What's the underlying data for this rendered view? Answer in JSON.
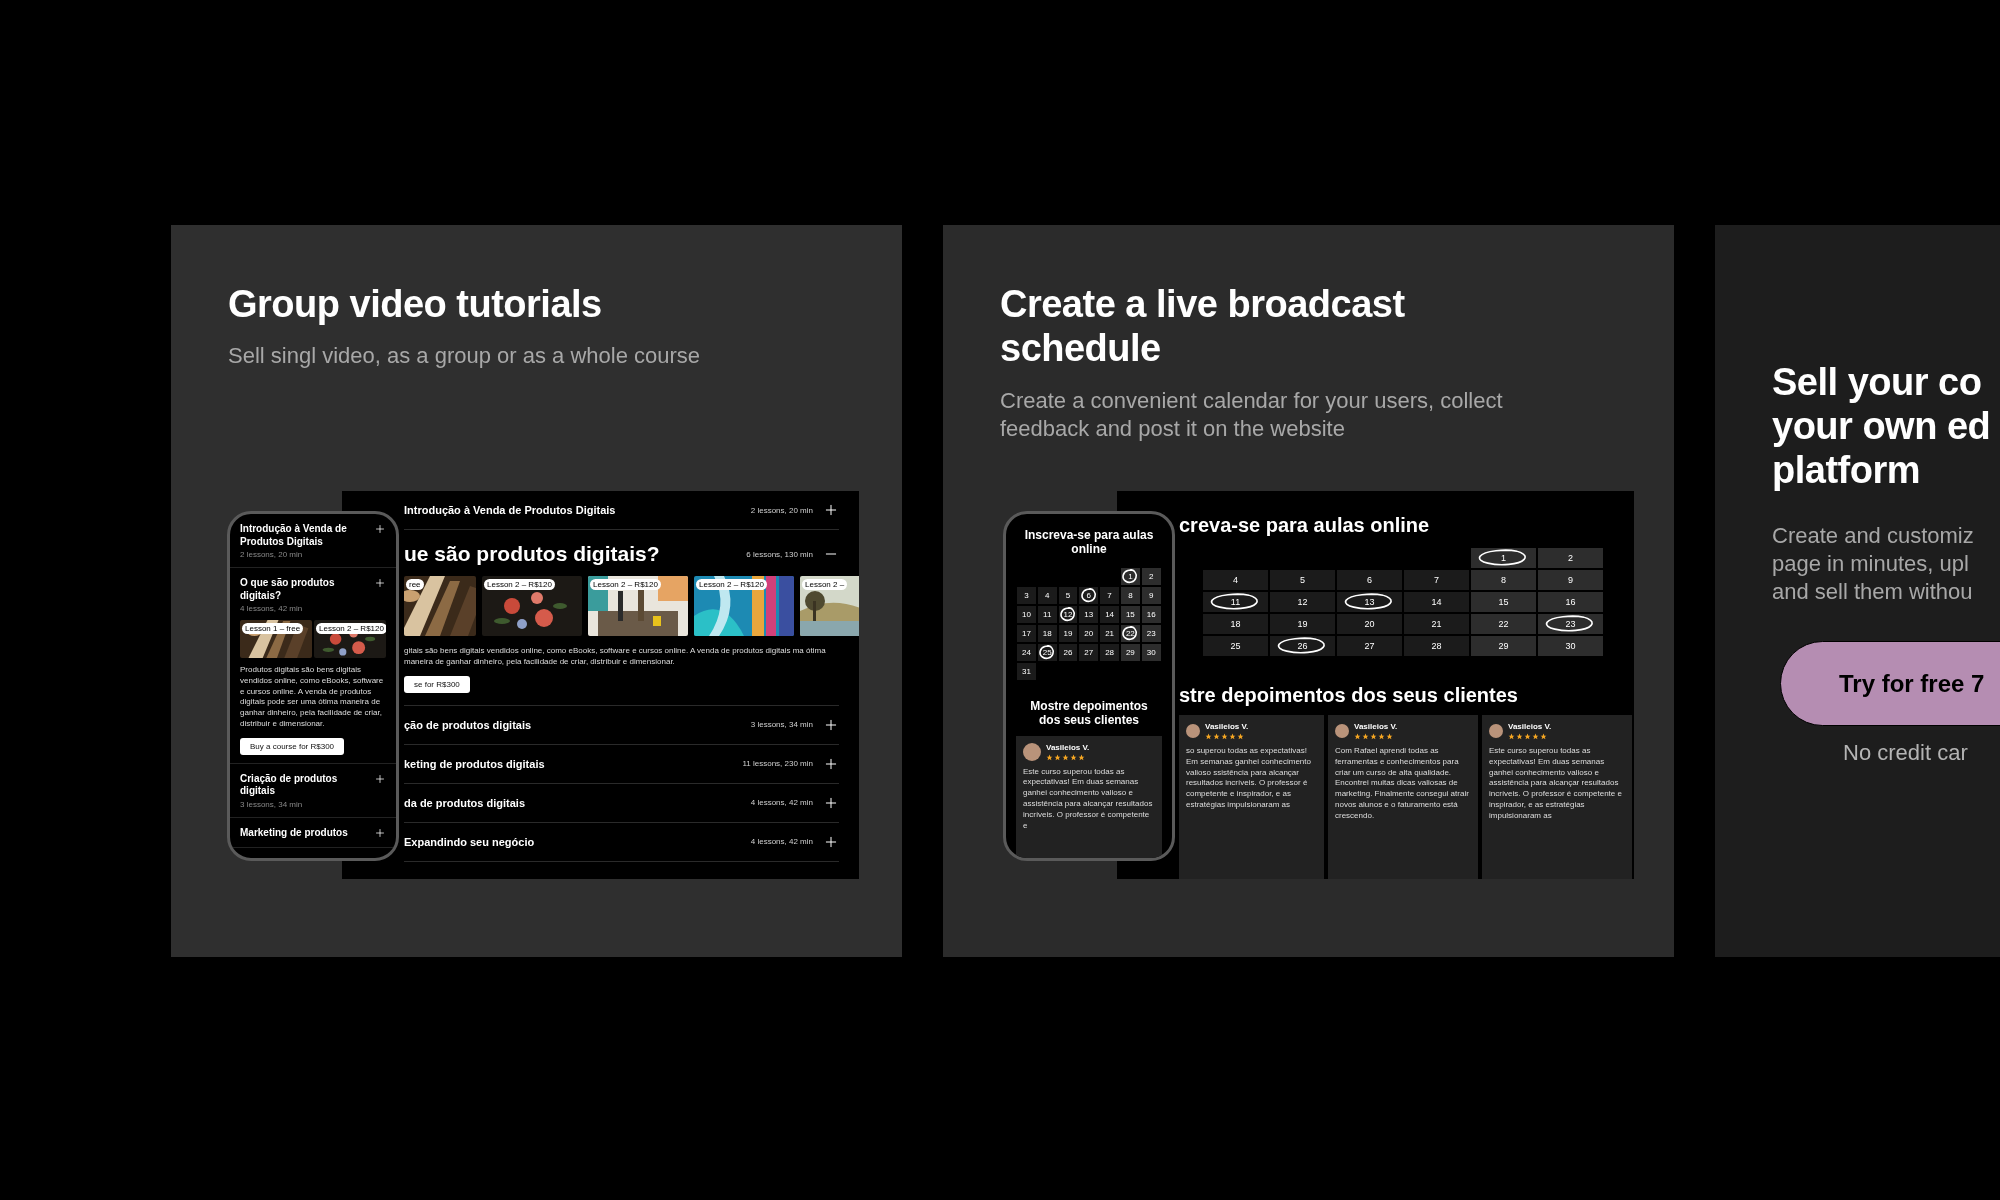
{
  "cards": [
    {
      "kind": "course",
      "title": "Group video tutorials",
      "subtitle": "Sell singl video, as a group or as a whole course",
      "desktop": {
        "sections": [
          {
            "title": "Introdução à Venda de Produtos Digitais",
            "meta": "2 lessons, 20 min",
            "expanded": false
          },
          {
            "title": "ue são produtos digitais?",
            "meta": "6 lessons, 130 min",
            "expanded": true,
            "lessons": [
              "ree",
              "Lesson 2 – R$120",
              "Lesson 2 – R$120",
              "Lesson 2 – R$120",
              "Lesson 2 –"
            ],
            "description": "gitais são bens digitais vendidos online, como eBooks, software e cursos online. A venda de produtos digitais ma ótima maneira de ganhar dinheiro, pela facilidade de criar, distribuir e dimensionar.",
            "buy": "se for R$300"
          },
          {
            "title": "ção de produtos digitais",
            "meta": "3 lessons, 34 min",
            "expanded": false
          },
          {
            "title": "keting de produtos digitais",
            "meta": "11 lessons, 230 min",
            "expanded": false
          },
          {
            "title": "da de produtos digitais",
            "meta": "4 lessons, 42 min",
            "expanded": false
          },
          {
            "title": "Expandindo seu negócio",
            "meta": "4 lessons, 42 min",
            "expanded": false
          }
        ]
      },
      "phone": {
        "sections": [
          {
            "title": "Introdução à Venda de Produtos Digitais",
            "meta": "2 lessons, 20 min",
            "expanded": false
          },
          {
            "title": "O que são produtos digitais?",
            "meta": "4 lessons, 42 min",
            "expanded": true,
            "lessons": [
              "Lesson 1 – free",
              "Lesson 2 – R$120"
            ],
            "description": "Produtos digitais são bens digitais vendidos online, como eBooks, software e cursos online. A venda de produtos digitais pode ser uma ótima maneira de ganhar dinheiro, pela facilidade de criar, distribuir e dimensionar.",
            "buy": "Buy a course for R$300"
          },
          {
            "title": "Criação de produtos digitais",
            "meta": "3 lessons, 34 min",
            "expanded": false
          },
          {
            "title": "Marketing de produtos",
            "expanded": false
          }
        ]
      }
    },
    {
      "kind": "schedule",
      "title": "Create a live broadcast schedule",
      "subtitle": "Create a convenient calendar for your users, collect feedback and post it on the website",
      "desktop": {
        "calendar_title": "creva-se para aulas online",
        "weeks": [
          [
            {
              "day": "1",
              "circled": true
            },
            {
              "day": "2",
              "circled": false
            }
          ],
          [
            {
              "day": "4",
              "circled": false
            },
            {
              "day": "5",
              "circled": false
            },
            {
              "day": "6",
              "circled": false
            },
            {
              "day": "7",
              "circled": false
            },
            {
              "day": "8",
              "circled": false
            },
            {
              "day": "9",
              "circled": false
            }
          ],
          [
            {
              "day": "11",
              "circled": true
            },
            {
              "day": "12",
              "circled": false
            },
            {
              "day": "13",
              "circled": true
            },
            {
              "day": "14",
              "circled": false
            },
            {
              "day": "15",
              "circled": false
            },
            {
              "day": "16",
              "circled": false
            }
          ],
          [
            {
              "day": "18",
              "circled": false
            },
            {
              "day": "19",
              "circled": false
            },
            {
              "day": "20",
              "circled": false
            },
            {
              "day": "21",
              "circled": false
            },
            {
              "day": "22",
              "circled": false
            },
            {
              "day": "23",
              "circled": true
            }
          ],
          [
            {
              "day": "25",
              "circled": false
            },
            {
              "day": "26",
              "circled": true
            },
            {
              "day": "27",
              "circled": false
            },
            {
              "day": "28",
              "circled": false
            },
            {
              "day": "29",
              "circled": false
            },
            {
              "day": "30",
              "circled": false
            }
          ]
        ],
        "testimonials_title": "stre depoimentos dos seus clientes",
        "testimonials": [
          {
            "name": "Vasileios V.",
            "stars": 5,
            "text": "so superou todas as expectativas! Em semanas ganhei conhecimento valioso ssistência para alcançar resultados incríveis. O professor é competente e inspirador, e as estratégias impulsionaram as"
          },
          {
            "name": "Vasileios V.",
            "stars": 5,
            "text": "Com Rafael aprendi todas as ferramentas e conhecimentos para criar um curso de alta qualidade. Encontrei muitas dicas valiosas de marketing. Finalmente consegui atrair novos alunos e o faturamento está crescendo."
          },
          {
            "name": "Vasileios V.",
            "stars": 5,
            "text": "Este curso superou todas as expectativas! Em duas semanas ganhei conhecimento valioso e assistência para alcançar resultados incríveis. O professor é competente e inspirador, e as estratégias impulsionaram as"
          }
        ]
      },
      "phone": {
        "calendar_title": "Inscreva-se para aulas online",
        "weeks": [
          [
            {
              "day": "1",
              "circled": true
            },
            {
              "day": "2",
              "circled": false
            }
          ],
          [
            {
              "day": "3",
              "circled": false
            },
            {
              "day": "4",
              "circled": false
            },
            {
              "day": "5",
              "circled": false
            },
            {
              "day": "6",
              "circled": true
            },
            {
              "day": "7",
              "circled": false
            },
            {
              "day": "8",
              "circled": false
            },
            {
              "day": "9",
              "circled": false
            }
          ],
          [
            {
              "day": "10",
              "circled": false
            },
            {
              "day": "11",
              "circled": false
            },
            {
              "day": "12",
              "circled": true
            },
            {
              "day": "13",
              "circled": false
            },
            {
              "day": "14",
              "circled": false
            },
            {
              "day": "15",
              "circled": false
            },
            {
              "day": "16",
              "circled": false
            }
          ],
          [
            {
              "day": "17",
              "circled": false
            },
            {
              "day": "18",
              "circled": false
            },
            {
              "day": "19",
              "circled": false
            },
            {
              "day": "20",
              "circled": false
            },
            {
              "day": "21",
              "circled": false
            },
            {
              "day": "22",
              "circled": true
            },
            {
              "day": "23",
              "circled": false
            }
          ],
          [
            {
              "day": "24",
              "circled": false
            },
            {
              "day": "25",
              "circled": true
            },
            {
              "day": "26",
              "circled": false
            },
            {
              "day": "27",
              "circled": false
            },
            {
              "day": "28",
              "circled": false
            },
            {
              "day": "29",
              "circled": false
            },
            {
              "day": "30",
              "circled": false
            }
          ],
          [
            {
              "day": "31",
              "circled": false
            }
          ]
        ],
        "testimonials_title": "Mostre depoimentos dos seus clientes",
        "testimonials": [
          {
            "name": "Vasileios V.",
            "stars": 5,
            "text": "Este curso superou todas as expectativas! Em duas semanas ganhei conhecimento valioso e assistência para alcançar resultados incríveis. O professor é competente e"
          }
        ]
      }
    },
    {
      "kind": "cta",
      "title_lines": [
        "Sell your co",
        "your own ed",
        "platform"
      ],
      "subtitle_lines": [
        "Create and customiz",
        "page in minutes, upl",
        "and sell them withou"
      ],
      "button": "Try for free 7",
      "note": "No credit car"
    }
  ]
}
